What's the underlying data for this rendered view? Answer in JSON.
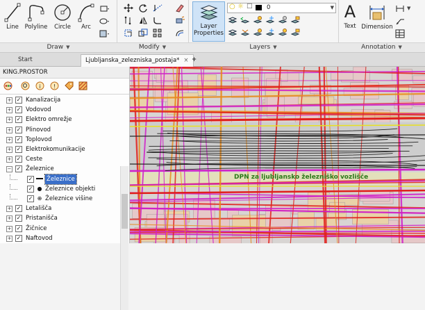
{
  "ribbon": {
    "draw": {
      "title": "Draw",
      "tools": [
        {
          "label": "Line",
          "icon": "line-icon"
        },
        {
          "label": "Polyline",
          "icon": "polyline-icon"
        },
        {
          "label": "Circle",
          "icon": "circle-icon"
        },
        {
          "label": "Arc",
          "icon": "arc-icon"
        }
      ]
    },
    "modify": {
      "title": "Modify"
    },
    "layers": {
      "title": "Layers",
      "layer_properties_label_line1": "Layer",
      "layer_properties_label_line2": "Properties",
      "current_layer": "0"
    },
    "annotation": {
      "title": "Annotation",
      "text_label": "Text",
      "dimension_label": "Dimension",
      "text_glyph": "A"
    }
  },
  "tabs": [
    {
      "label": "Start"
    },
    {
      "label": "Ljubljanska_zelezniska_postaja*",
      "close": "×"
    },
    {
      "label": "+"
    }
  ],
  "left_panel": {
    "title": "KING.PROSTOR",
    "tree": [
      {
        "label": "Kanalizacija",
        "expander": "+",
        "checked": "✓"
      },
      {
        "label": "Vodovod",
        "expander": "+",
        "checked": "✓"
      },
      {
        "label": "Elektro omrežje",
        "expander": "+",
        "checked": "✓"
      },
      {
        "label": "Plinovod",
        "expander": "+",
        "checked": "✓"
      },
      {
        "label": "Toplovod",
        "expander": "+",
        "checked": "✓"
      },
      {
        "label": "Elektrokomunikacije",
        "expander": "+",
        "checked": "✓"
      },
      {
        "label": "Ceste",
        "expander": "+",
        "checked": "✓"
      },
      {
        "label": "Železnice",
        "expander": "−",
        "checked": "✓"
      },
      {
        "label": "Železnice",
        "expander": "",
        "checked": "✓",
        "child": true,
        "selected": true,
        "marker": "line"
      },
      {
        "label": "Železnice objekti",
        "expander": "",
        "checked": "✓",
        "child": true,
        "marker": "dot"
      },
      {
        "label": "Železnice višine",
        "expander": "",
        "checked": "✓",
        "child": true,
        "marker": "cross"
      },
      {
        "label": "Letališča",
        "expander": "+",
        "checked": "✓"
      },
      {
        "label": "Pristanišča",
        "expander": "+",
        "checked": "✓"
      },
      {
        "label": "Žičnice",
        "expander": "+",
        "checked": "✓"
      },
      {
        "label": "Naftovod",
        "expander": "+",
        "checked": "✓"
      }
    ]
  },
  "map": {
    "annotation_text": "DPN za ljubljansko železniško vozlišče",
    "colors": {
      "background": "#d8d5d3",
      "building": "#e6c8c8",
      "red": "#e0201c",
      "magenta": "#d020c8",
      "orange": "#e88a1a",
      "yellow": "#e8e020",
      "track": "#222222",
      "annotation": "#2a7a1a"
    }
  }
}
